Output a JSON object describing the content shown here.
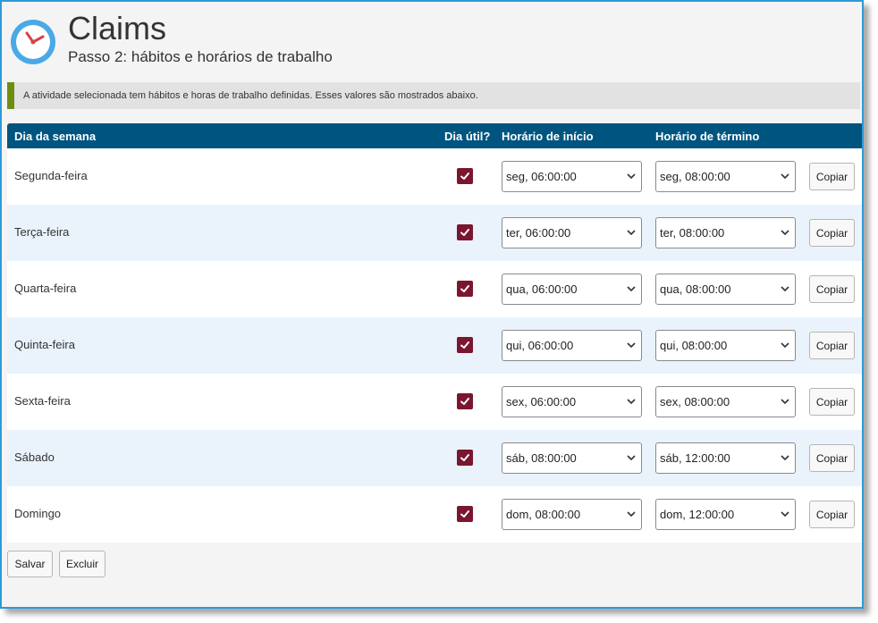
{
  "app": {
    "title": "Claims",
    "subtitle": "Passo 2: hábitos e horários de trabalho"
  },
  "info_message": "A atividade selecionada tem hábitos e horas de trabalho definidas. Esses valores são mostrados abaixo.",
  "table": {
    "headers": {
      "day": "Dia da semana",
      "workday": "Dia útil?",
      "start": "Horário de início",
      "end": "Horário de término"
    },
    "copy_label": "Copiar",
    "rows": [
      {
        "day": "Segunda-feira",
        "workday": true,
        "start": "seg, 06:00:00",
        "end": "seg, 08:00:00"
      },
      {
        "day": "Terça-feira",
        "workday": true,
        "start": "ter, 06:00:00",
        "end": "ter, 08:00:00"
      },
      {
        "day": "Quarta-feira",
        "workday": true,
        "start": "qua, 06:00:00",
        "end": "qua, 08:00:00"
      },
      {
        "day": "Quinta-feira",
        "workday": true,
        "start": "qui, 06:00:00",
        "end": "qui, 08:00:00"
      },
      {
        "day": "Sexta-feira",
        "workday": true,
        "start": "sex, 06:00:00",
        "end": "sex, 08:00:00"
      },
      {
        "day": "Sábado",
        "workday": true,
        "start": "sáb, 08:00:00",
        "end": "sáb, 12:00:00"
      },
      {
        "day": "Domingo",
        "workday": true,
        "start": "dom, 08:00:00",
        "end": "dom, 12:00:00"
      }
    ]
  },
  "footer": {
    "save_label": "Salvar",
    "delete_label": "Excluir"
  },
  "colors": {
    "header_bg": "#005580",
    "checkbox": "#7a1630",
    "info_accent": "#6c8f13",
    "window_border": "#2e9bd6"
  }
}
